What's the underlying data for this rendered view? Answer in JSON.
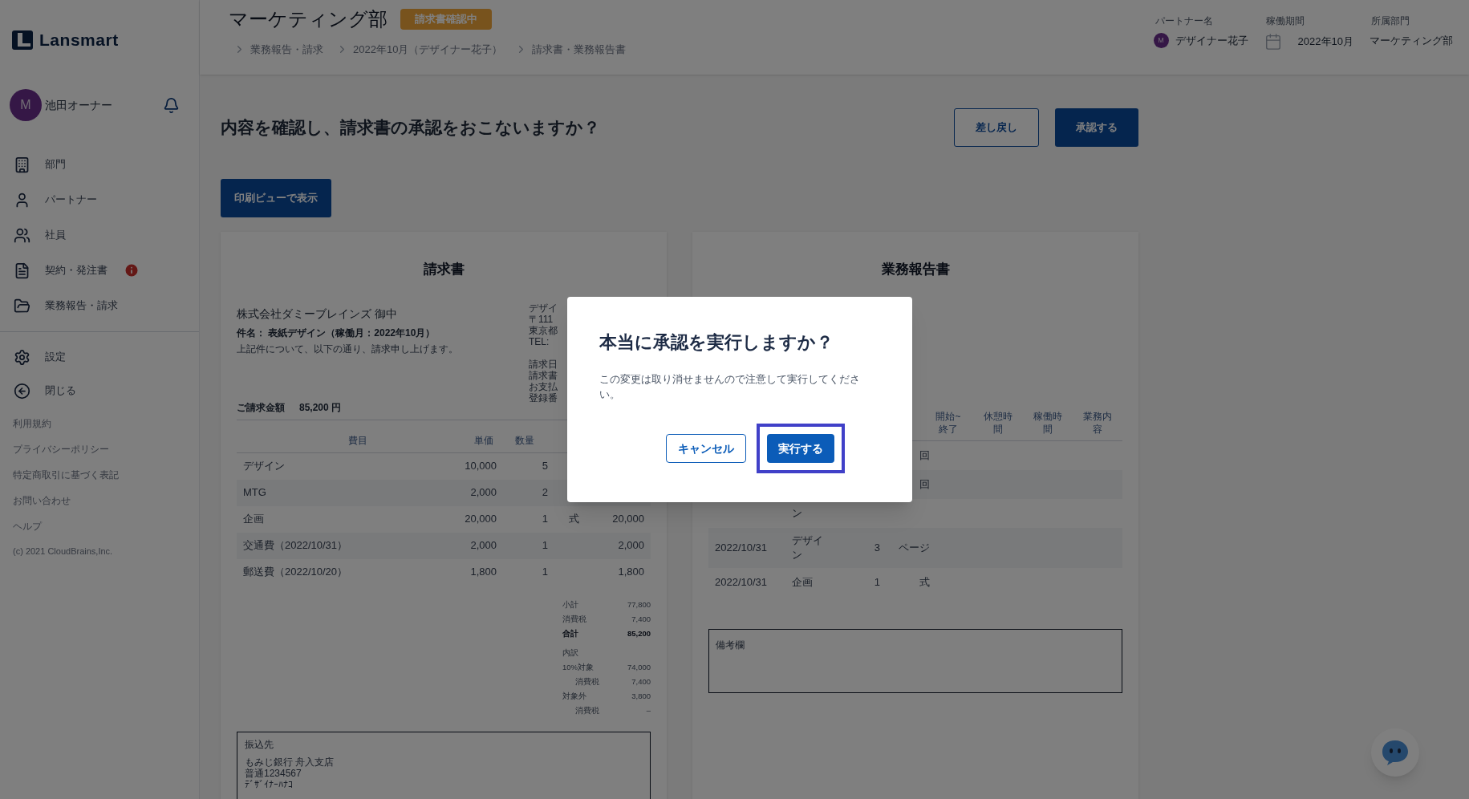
{
  "sidebar": {
    "logo": "Lansmart",
    "user": {
      "initial": "M",
      "name": "池田オーナー"
    },
    "nav": [
      {
        "label": "部門",
        "alert": false
      },
      {
        "label": "パートナー",
        "alert": false
      },
      {
        "label": "社員",
        "alert": false
      },
      {
        "label": "契約・発注書",
        "alert": true
      },
      {
        "label": "業務報告・請求",
        "alert": false
      }
    ],
    "bottom": [
      {
        "label": "設定"
      },
      {
        "label": "閉じる"
      }
    ],
    "links": [
      "利用規約",
      "プライバシーポリシー",
      "特定商取引に基づく表記",
      "お問い合わせ",
      "ヘルプ"
    ],
    "copyright": "(c) 2021 CloudBrains,Inc."
  },
  "header": {
    "title": "マーケティング部",
    "status": "請求書確認中",
    "breadcrumb": [
      "業務報告・請求",
      "2022年10月（デザイナー花子）",
      "請求書・業務報告書"
    ],
    "meta": [
      {
        "kind": "avatar",
        "label": "パートナー名",
        "initial": "M",
        "value": "デザイナー花子"
      },
      {
        "kind": "calendar",
        "label": "稼働期間",
        "value": "2022年10月"
      },
      {
        "kind": "text",
        "label": "所属部門",
        "value": "マーケティング部"
      }
    ]
  },
  "main": {
    "question": "内容を確認し、請求書の承認をおこないますか？",
    "actions": [
      {
        "kind": "secondary",
        "label": "差し戻し"
      },
      {
        "kind": "primary",
        "label": "承認する"
      }
    ],
    "print_button": "印刷ビューで表示"
  },
  "invoice": {
    "title": "請求書",
    "addressee": "株式会社ダミーブレインズ 御中",
    "subject": "件名： 表紙デザイン（稼働月：2022年10月）",
    "intro": "上記件について、以下の通り、請求申し上げます。",
    "issuer_fragments": [
      "デザイ",
      "〒111",
      "東京都",
      "TEL:",
      "請求日",
      "請求書",
      "お支払",
      "登録番"
    ],
    "total_label": "ご請求金額",
    "total": "85,200 円",
    "columns": [
      "費目",
      "単価",
      "数量"
    ],
    "rows": [
      {
        "item": "デザイン",
        "price": "10,000",
        "qty": "5"
      },
      {
        "item": "MTG",
        "price": "2,000",
        "qty": "2"
      },
      {
        "item": "企画",
        "price": "20,000",
        "qty": "1",
        "unit": "式",
        "amount": "20,000"
      },
      {
        "item": "交通費（2022/10/31）",
        "price": "2,000",
        "qty": "1",
        "amount": "2,000"
      },
      {
        "item": "郵送費（2022/10/20）",
        "price": "1,800",
        "qty": "1",
        "amount": "1,800"
      }
    ],
    "summary": [
      {
        "kind": "line",
        "label": "小計",
        "value": "77,800"
      },
      {
        "kind": "line",
        "label": "消費税",
        "value": "7,400"
      },
      {
        "kind": "total",
        "label": "合計",
        "value": "85,200"
      },
      {
        "kind": "heading",
        "label": "内訳"
      },
      {
        "kind": "line",
        "label": "10%対象",
        "value": "74,000"
      },
      {
        "kind": "sub",
        "label": "消費税",
        "value": "7,400"
      },
      {
        "kind": "line",
        "label": "対象外",
        "value": "3,800"
      },
      {
        "kind": "sub",
        "label": "消費税",
        "value": "–"
      }
    ],
    "bank": {
      "label": "振込先",
      "lines": [
        "もみじ銀行 舟入支店",
        "普通1234567",
        "ﾃﾞｻﾞｲﾅｰﾊﾅｺ"
      ]
    }
  },
  "report": {
    "title": "業務報告書",
    "columns": [
      "開始~終了",
      "休憩時間",
      "稼働時間",
      "業務内容"
    ],
    "rows": [
      {
        "unit": "回"
      },
      {
        "unit": "回"
      },
      {
        "item": "ン"
      },
      {
        "date": "2022/10/31",
        "item": "デザイン",
        "qty": "3",
        "unit": "ページ"
      },
      {
        "date": "2022/10/31",
        "item": "企画",
        "qty": "1",
        "unit": "式"
      }
    ],
    "remarks_label": "備考欄"
  },
  "dialog": {
    "title": "本当に承認を実行しますか？",
    "message": "この変更は取り消せませんので注意して実行してください。",
    "buttons": [
      {
        "kind": "secondary",
        "label": "キャンセル",
        "focused": false
      },
      {
        "kind": "primary",
        "label": "実行する",
        "focused": true
      }
    ]
  }
}
